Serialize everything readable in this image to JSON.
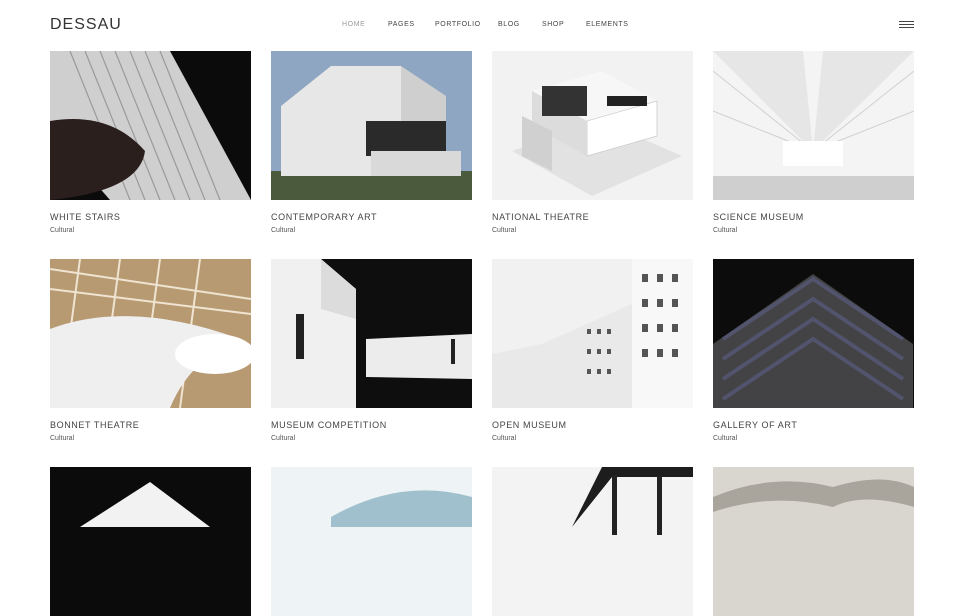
{
  "brand": {
    "logo": "DESSAU"
  },
  "nav": {
    "items": [
      {
        "label": "HOME",
        "active": true
      },
      {
        "label": "PAGES",
        "active": false
      },
      {
        "label": "PORTFOLIO",
        "active": false
      },
      {
        "label": "BLOG",
        "active": false
      },
      {
        "label": "SHOP",
        "active": false
      },
      {
        "label": "ELEMENTS",
        "active": false
      }
    ],
    "menu_icon": "hamburger-menu-icon"
  },
  "portfolio": {
    "items": [
      {
        "title": "WHITE STAIRS",
        "category": "Cultural"
      },
      {
        "title": "CONTEMPORARY ART",
        "category": "Cultural"
      },
      {
        "title": "NATIONAL THEATRE",
        "category": "Cultural"
      },
      {
        "title": "SCIENCE MUSEUM",
        "category": "Cultural"
      },
      {
        "title": "BONNET THEATRE",
        "category": "Cultural"
      },
      {
        "title": "MUSEUM COMPETITION",
        "category": "Cultural"
      },
      {
        "title": "OPEN MUSEUM",
        "category": "Cultural"
      },
      {
        "title": "GALLERY OF ART",
        "category": "Cultural"
      }
    ]
  },
  "colors": {
    "background": "#ffffff",
    "text": "#444444",
    "nav_active": "#9a9a9a"
  }
}
